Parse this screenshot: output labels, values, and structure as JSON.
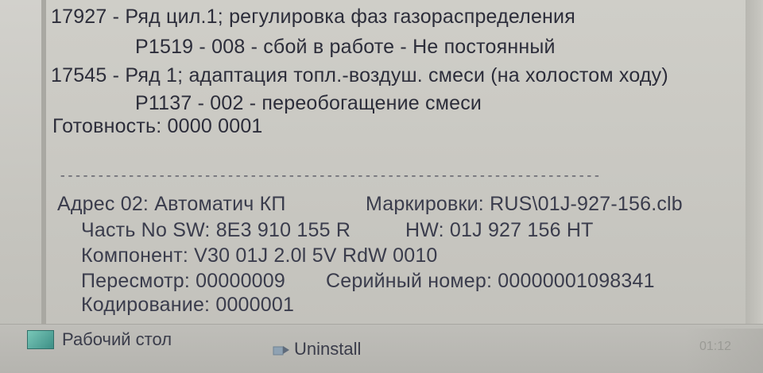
{
  "window": {
    "lines": [
      "17927 - Ряд цил.1; регулировка фаз газораспределения",
      "P1519 - 008 - сбой в работе - Не постоянный",
      "17545 - Ряд 1; адаптация топл.-воздуш. смеси (на холостом ходу)",
      "P1137 - 002 - переобогащение смеси",
      "Готовность: 0000 0001"
    ],
    "separator": "-------------------------------------------------------------------------------------------",
    "module": {
      "address": "Адрес 02: Автоматич КП",
      "markings": "Маркировки: RUS\\01J-927-156.clb",
      "part_sw": "Часть No SW: 8E3 910 155 R",
      "hw": "HW: 01J 927 156 HT",
      "component": "Компонент: V30 01J 2.0l 5V RdW 0010",
      "revision": "Пересмотр: 00000009",
      "serial": "Серийный номер: 00000001098341",
      "coding": "Кодирование: 0000001"
    }
  },
  "taskbar": {
    "desktop_label": "Рабочий стол",
    "uninstall_label": "Uninstall",
    "clock": "01:12"
  },
  "icons": {
    "desktop": "desktop-icon",
    "uninstall": "uninstall-icon"
  }
}
